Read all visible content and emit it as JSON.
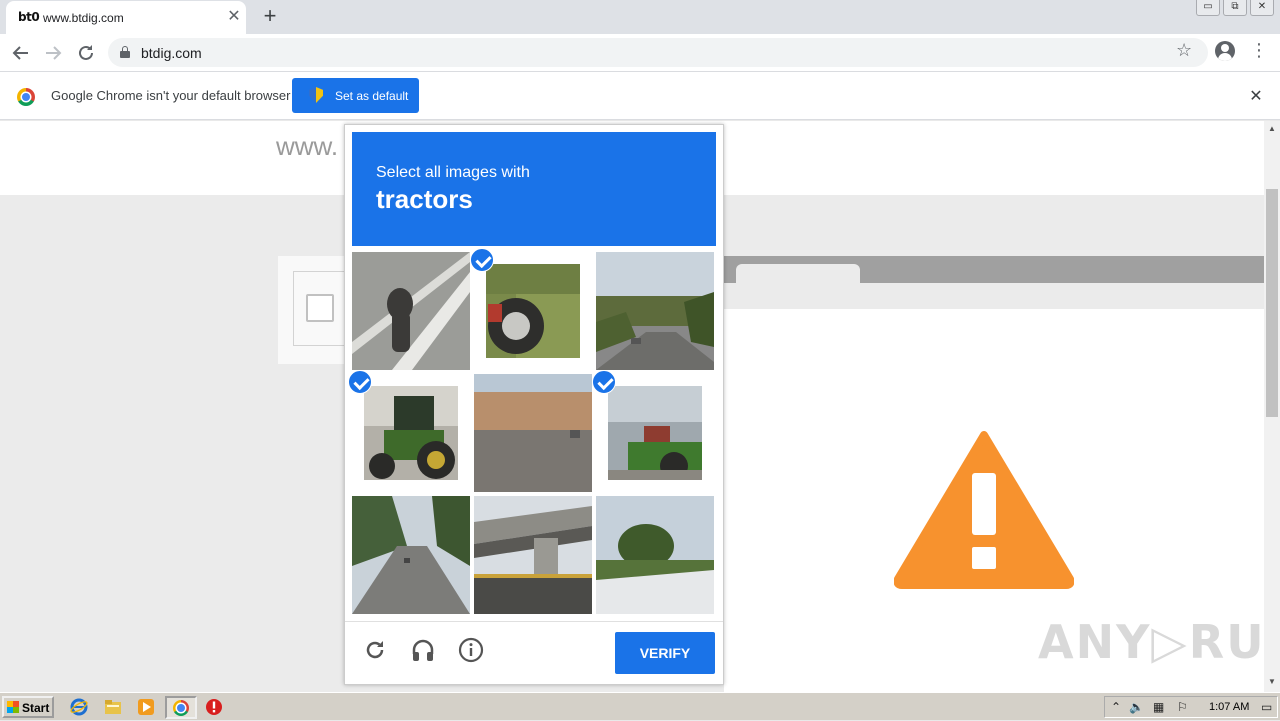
{
  "browser": {
    "tab": {
      "favicon_text": "bt0",
      "title": "www.btdig.com",
      "close_glyph": "✕"
    },
    "new_tab_glyph": "+",
    "window_controls": [
      "▭",
      "⧉",
      "✕"
    ],
    "url": "btdig.com",
    "icons": [
      "back-arrow-icon",
      "forward-arrow-icon",
      "reload-icon",
      "lock-icon",
      "star-icon",
      "account-icon",
      "menu-icon"
    ]
  },
  "infobar": {
    "message": "Google Chrome isn't your default browser",
    "button_label": "Set as default",
    "close_glyph": "✕"
  },
  "page": {
    "heading_fragment": "www.",
    "watermark": "ANY▷RUN",
    "warning_color": "#f7922e"
  },
  "challenge": {
    "instruction": "Select all images with",
    "keyword": "tractors",
    "accent_color": "#1a73e8",
    "tiles": [
      {
        "subject": "shadow on road",
        "selected": false
      },
      {
        "subject": "tractor wheel",
        "selected": true
      },
      {
        "subject": "street with trees",
        "selected": false
      },
      {
        "subject": "green tractor",
        "selected": true
      },
      {
        "subject": "parking lot",
        "selected": false
      },
      {
        "subject": "tractor by building",
        "selected": true
      },
      {
        "subject": "tree-lined road",
        "selected": false
      },
      {
        "subject": "overpass",
        "selected": false
      },
      {
        "subject": "trees and car roof",
        "selected": false
      }
    ],
    "footer": {
      "icons": [
        "reload-icon",
        "audio-icon",
        "info-icon"
      ],
      "verify_label": "VERIFY"
    }
  },
  "taskbar": {
    "start_label": "Start",
    "clock": "1:07 AM",
    "tray_icons": [
      "show-hidden-icon",
      "speaker-icon",
      "network-icon",
      "flag-icon",
      "monitor-icon"
    ]
  }
}
